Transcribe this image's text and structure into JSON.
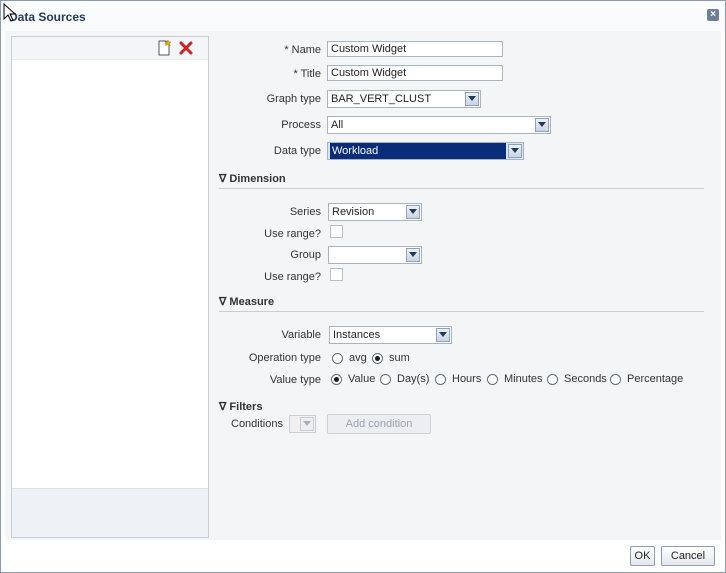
{
  "dialog": {
    "title": "Data Sources"
  },
  "form": {
    "name": {
      "label": "Name",
      "value": "Custom Widget"
    },
    "title": {
      "label": "Title",
      "value": "Custom Widget"
    },
    "graph_type": {
      "label": "Graph type",
      "value": "BAR_VERT_CLUST"
    },
    "process": {
      "label": "Process",
      "value": "All"
    },
    "data_type": {
      "label": "Data type",
      "value": "Workload"
    }
  },
  "dimension": {
    "header": "Dimension",
    "series": {
      "label": "Series",
      "value": "Revision"
    },
    "series_use_range": {
      "label": "Use range?"
    },
    "group": {
      "label": "Group",
      "value": ""
    },
    "group_use_range": {
      "label": "Use range?"
    }
  },
  "measure": {
    "header": "Measure",
    "variable": {
      "label": "Variable",
      "value": "Instances"
    },
    "operation_type": {
      "label": "Operation type",
      "options": [
        "avg",
        "sum"
      ],
      "selected": "sum"
    },
    "value_type": {
      "label": "Value type",
      "options": [
        "Value",
        "Day(s)",
        "Hours",
        "Minutes",
        "Seconds",
        "Percentage"
      ],
      "selected": "Value"
    }
  },
  "filters": {
    "header": "Filters",
    "conditions_label": "Conditions",
    "add_condition": "Add condition"
  },
  "footer": {
    "ok": "OK",
    "cancel": "Cancel"
  },
  "icons": {
    "new": "new-document-icon",
    "delete": "delete-x-icon",
    "close": "close-icon"
  },
  "colors": {
    "selected_option": "#0a2d7a",
    "delete_icon": "#cc2222"
  }
}
